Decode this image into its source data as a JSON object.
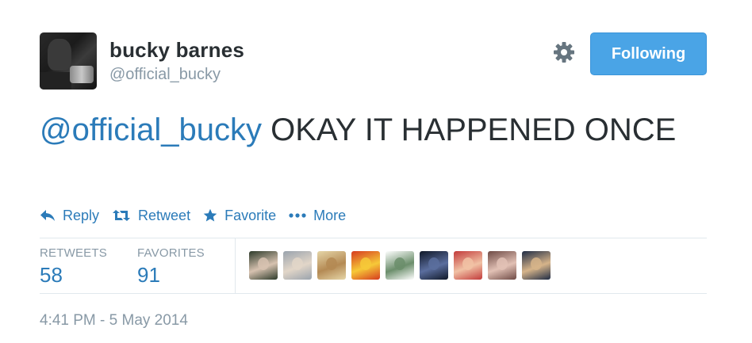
{
  "user": {
    "name": "bucky barnes",
    "handle": "@official_bucky"
  },
  "follow_button": {
    "label": "Following"
  },
  "tweet": {
    "mention": "@official_bucky",
    "text": " OKAY IT HAPPENED ONCE"
  },
  "actions": [
    {
      "label": "Reply",
      "icon": "reply-icon"
    },
    {
      "label": "Retweet",
      "icon": "retweet-icon"
    },
    {
      "label": "Favorite",
      "icon": "star-icon"
    },
    {
      "label": "More",
      "icon": "more-icon"
    }
  ],
  "stats": {
    "retweets_label": "RETWEETS",
    "retweets_count": "58",
    "favorites_label": "FAVORITES",
    "favorites_count": "91"
  },
  "favoriters": [
    {
      "colors": [
        "#2c3a2a",
        "#d7c2b0"
      ]
    },
    {
      "colors": [
        "#9aa3ad",
        "#e2d6c8"
      ]
    },
    {
      "colors": [
        "#e6d6a8",
        "#b48a54"
      ]
    },
    {
      "colors": [
        "#d63b1f",
        "#f6c938"
      ]
    },
    {
      "colors": [
        "#ffffff",
        "#6b8e6b"
      ]
    },
    {
      "colors": [
        "#101828",
        "#5b6e9e"
      ]
    },
    {
      "colors": [
        "#c23a3a",
        "#f1c2a5"
      ]
    },
    {
      "colors": [
        "#6e4a45",
        "#e2c1b5"
      ]
    },
    {
      "colors": [
        "#1e2b44",
        "#d6b48a"
      ]
    }
  ],
  "timestamp": "4:41 PM - 5 May 2014",
  "colors": {
    "link": "#2b7bb9",
    "follow_button_bg": "#4aa4e6",
    "muted": "#8899a6",
    "text": "#292f33"
  }
}
